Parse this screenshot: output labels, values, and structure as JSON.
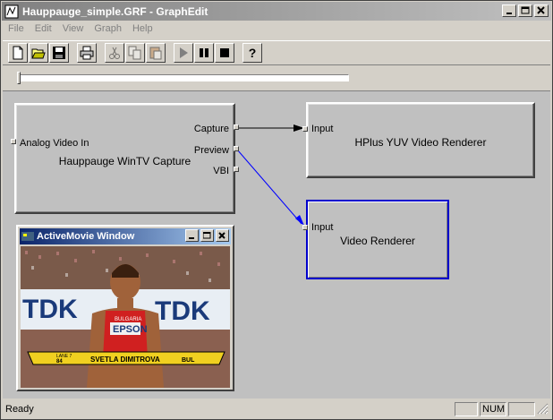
{
  "window": {
    "title": "Hauppauge_simple.GRF - GraphEdit",
    "buttons": {
      "minimize": "_",
      "maximize": "□",
      "close": "×"
    }
  },
  "menu": [
    "File",
    "Edit",
    "View",
    "Graph",
    "Help"
  ],
  "toolbar": {
    "buttons": [
      {
        "name": "new-icon",
        "enabled": true
      },
      {
        "name": "open-icon",
        "enabled": true
      },
      {
        "name": "save-icon",
        "enabled": true
      },
      {
        "name": "print-icon",
        "enabled": true
      },
      {
        "name": "cut-icon",
        "enabled": false
      },
      {
        "name": "copy-icon",
        "enabled": false
      },
      {
        "name": "paste-icon",
        "enabled": false
      },
      {
        "name": "play-icon",
        "enabled": true
      },
      {
        "name": "pause-icon",
        "enabled": true
      },
      {
        "name": "stop-icon",
        "enabled": true
      },
      {
        "name": "help-icon",
        "enabled": true
      }
    ],
    "help_glyph": "?"
  },
  "seek": {
    "position": 0
  },
  "filters": {
    "capture": {
      "name": "Hauppauge WinTV Capture",
      "input_pin": "Analog Video In",
      "output_pins": [
        "Capture",
        "Preview",
        "VBI"
      ]
    },
    "hplus": {
      "name": "HPlus YUV Video Renderer",
      "input_pin": "Input"
    },
    "renderer": {
      "name": "Video Renderer",
      "input_pin": "Input"
    }
  },
  "activemovie": {
    "title": "ActiveMovie Window",
    "video_text": {
      "banner1": "TDK",
      "banner2": "TDK",
      "sponsor": "EPSON",
      "bib_text": "BULGARIA",
      "caption_lane": "LANE 7",
      "caption_num": "84",
      "caption_name": "SVETLA DIMITROVA",
      "caption_country": "BUL"
    }
  },
  "status": {
    "text": "Ready",
    "num": "NUM"
  },
  "colors": {
    "preview_connection": "#0000ff",
    "capture_connection": "#000000",
    "selected_border": "#0000cc"
  }
}
